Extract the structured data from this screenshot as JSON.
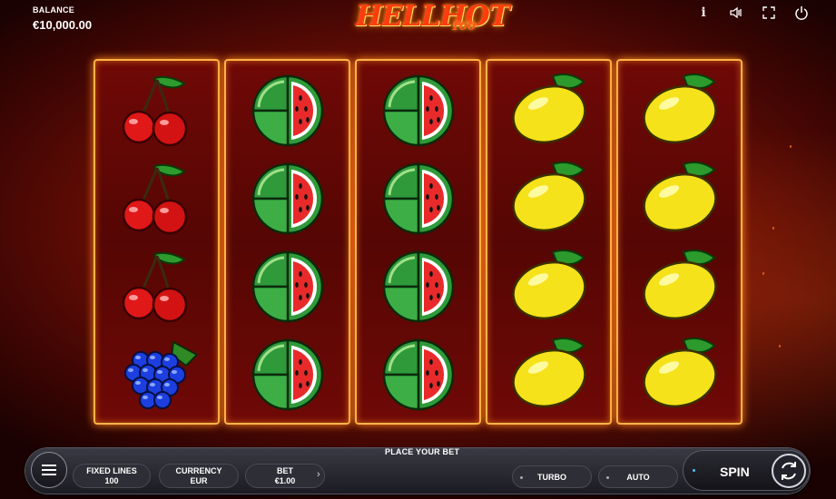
{
  "balance": {
    "label": "BALANCE",
    "value": "€10,000.00"
  },
  "logo": {
    "main": "HELLHOT",
    "sub": "100"
  },
  "top_icons": [
    "info-icon",
    "sound-icon",
    "fullscreen-icon",
    "power-icon"
  ],
  "reels": [
    [
      "cherry",
      "cherry",
      "cherry",
      "grapes"
    ],
    [
      "watermelon",
      "watermelon",
      "watermelon",
      "watermelon"
    ],
    [
      "watermelon",
      "watermelon",
      "watermelon",
      "watermelon"
    ],
    [
      "lemon",
      "lemon",
      "lemon",
      "lemon"
    ],
    [
      "lemon",
      "lemon",
      "lemon",
      "lemon"
    ]
  ],
  "bottom_bar": {
    "title": "PLACE YOUR BET",
    "fixed_lines": {
      "label": "FIXED LINES",
      "value": "100"
    },
    "currency": {
      "label": "CURRENCY",
      "value": "EUR"
    },
    "bet": {
      "label": "BET",
      "value": "€1.00"
    },
    "turbo_label": "TURBO",
    "auto_label": "AUTO",
    "spin_label": "SPIN"
  },
  "colors": {
    "reel_border": "#ffb347",
    "background": "#7a1006",
    "accent": "#4fc3f7"
  }
}
